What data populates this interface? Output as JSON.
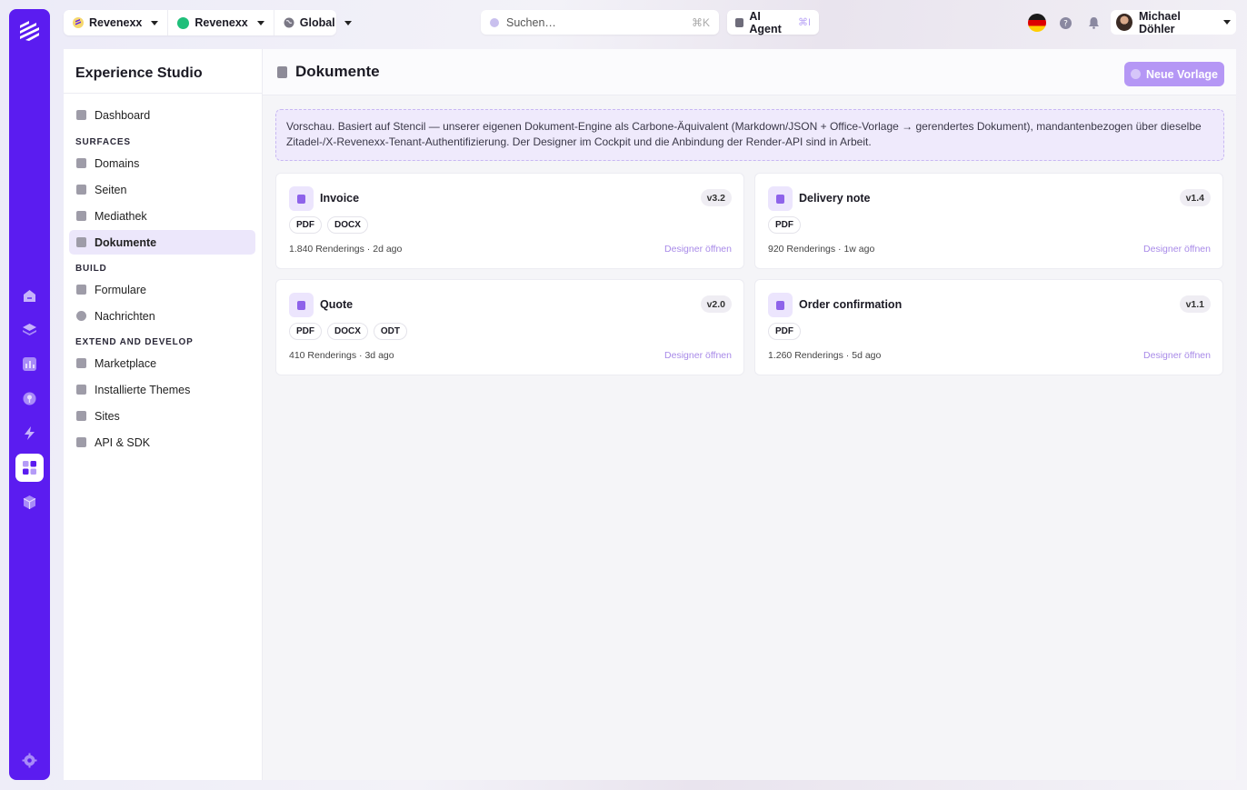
{
  "rail": {
    "items": [
      {
        "icon": "home-icon"
      },
      {
        "icon": "layers-icon"
      },
      {
        "icon": "chart-icon"
      },
      {
        "icon": "pin-icon"
      },
      {
        "icon": "bolt-icon"
      },
      {
        "icon": "grid-icon",
        "active": true
      },
      {
        "icon": "cube-icon"
      }
    ],
    "settings_icon": "gear-icon"
  },
  "topbar": {
    "org_label": "Revenexx",
    "tenant_label": "Revenexx",
    "region_label": "Global",
    "search_placeholder": "Suchen…",
    "search_shortcut": "⌘K",
    "agent_label": "AI Agent",
    "agent_shortcut": "⌘I",
    "user_name": "Michael Döhler"
  },
  "sidebar": {
    "title": "Experience Studio",
    "dashboard": "Dashboard",
    "sections": {
      "surfaces": "SURFACES",
      "build": "BUILD",
      "extend": "EXTEND AND DEVELOP"
    },
    "surfaces_items": [
      "Domains",
      "Seiten",
      "Mediathek",
      "Dokumente"
    ],
    "build_items": [
      "Formulare",
      "Nachrichten"
    ],
    "extend_items": [
      "Marketplace",
      "Installierte Themes",
      "Sites",
      "API & SDK"
    ]
  },
  "main": {
    "title": "Dokumente",
    "new_button": "Neue Vorlage",
    "notice": "Vorschau. Basiert auf Stencil — unserer eigenen Dokument-Engine als Carbone-Äquivalent (Markdown/JSON + Office-Vorlage → gerendertes Dokument), mandantenbezogen über dieselbe Zitadel-/X-Revenexx-Tenant-Authentifizierung. Der Designer im Cockpit und die Anbindung der Render-API sind in Arbeit.",
    "cards": [
      {
        "name": "Invoice",
        "version": "v3.2",
        "formats": [
          "PDF",
          "DOCX"
        ],
        "meta": "1.840 Renderings · 2d ago",
        "link": "Designer öffnen"
      },
      {
        "name": "Delivery note",
        "version": "v1.4",
        "formats": [
          "PDF"
        ],
        "meta": "920 Renderings · 1w ago",
        "link": "Designer öffnen"
      },
      {
        "name": "Quote",
        "version": "v2.0",
        "formats": [
          "PDF",
          "DOCX",
          "ODT"
        ],
        "meta": "410 Renderings · 3d ago",
        "link": "Designer öffnen"
      },
      {
        "name": "Order confirmation",
        "version": "v1.1",
        "formats": [
          "PDF"
        ],
        "meta": "1.260 Renderings · 5d ago",
        "link": "Designer öffnen"
      }
    ]
  },
  "colors": {
    "rail": "#5b1cf0",
    "accent": "#b597f5",
    "active_bg": "#ece7fb"
  }
}
